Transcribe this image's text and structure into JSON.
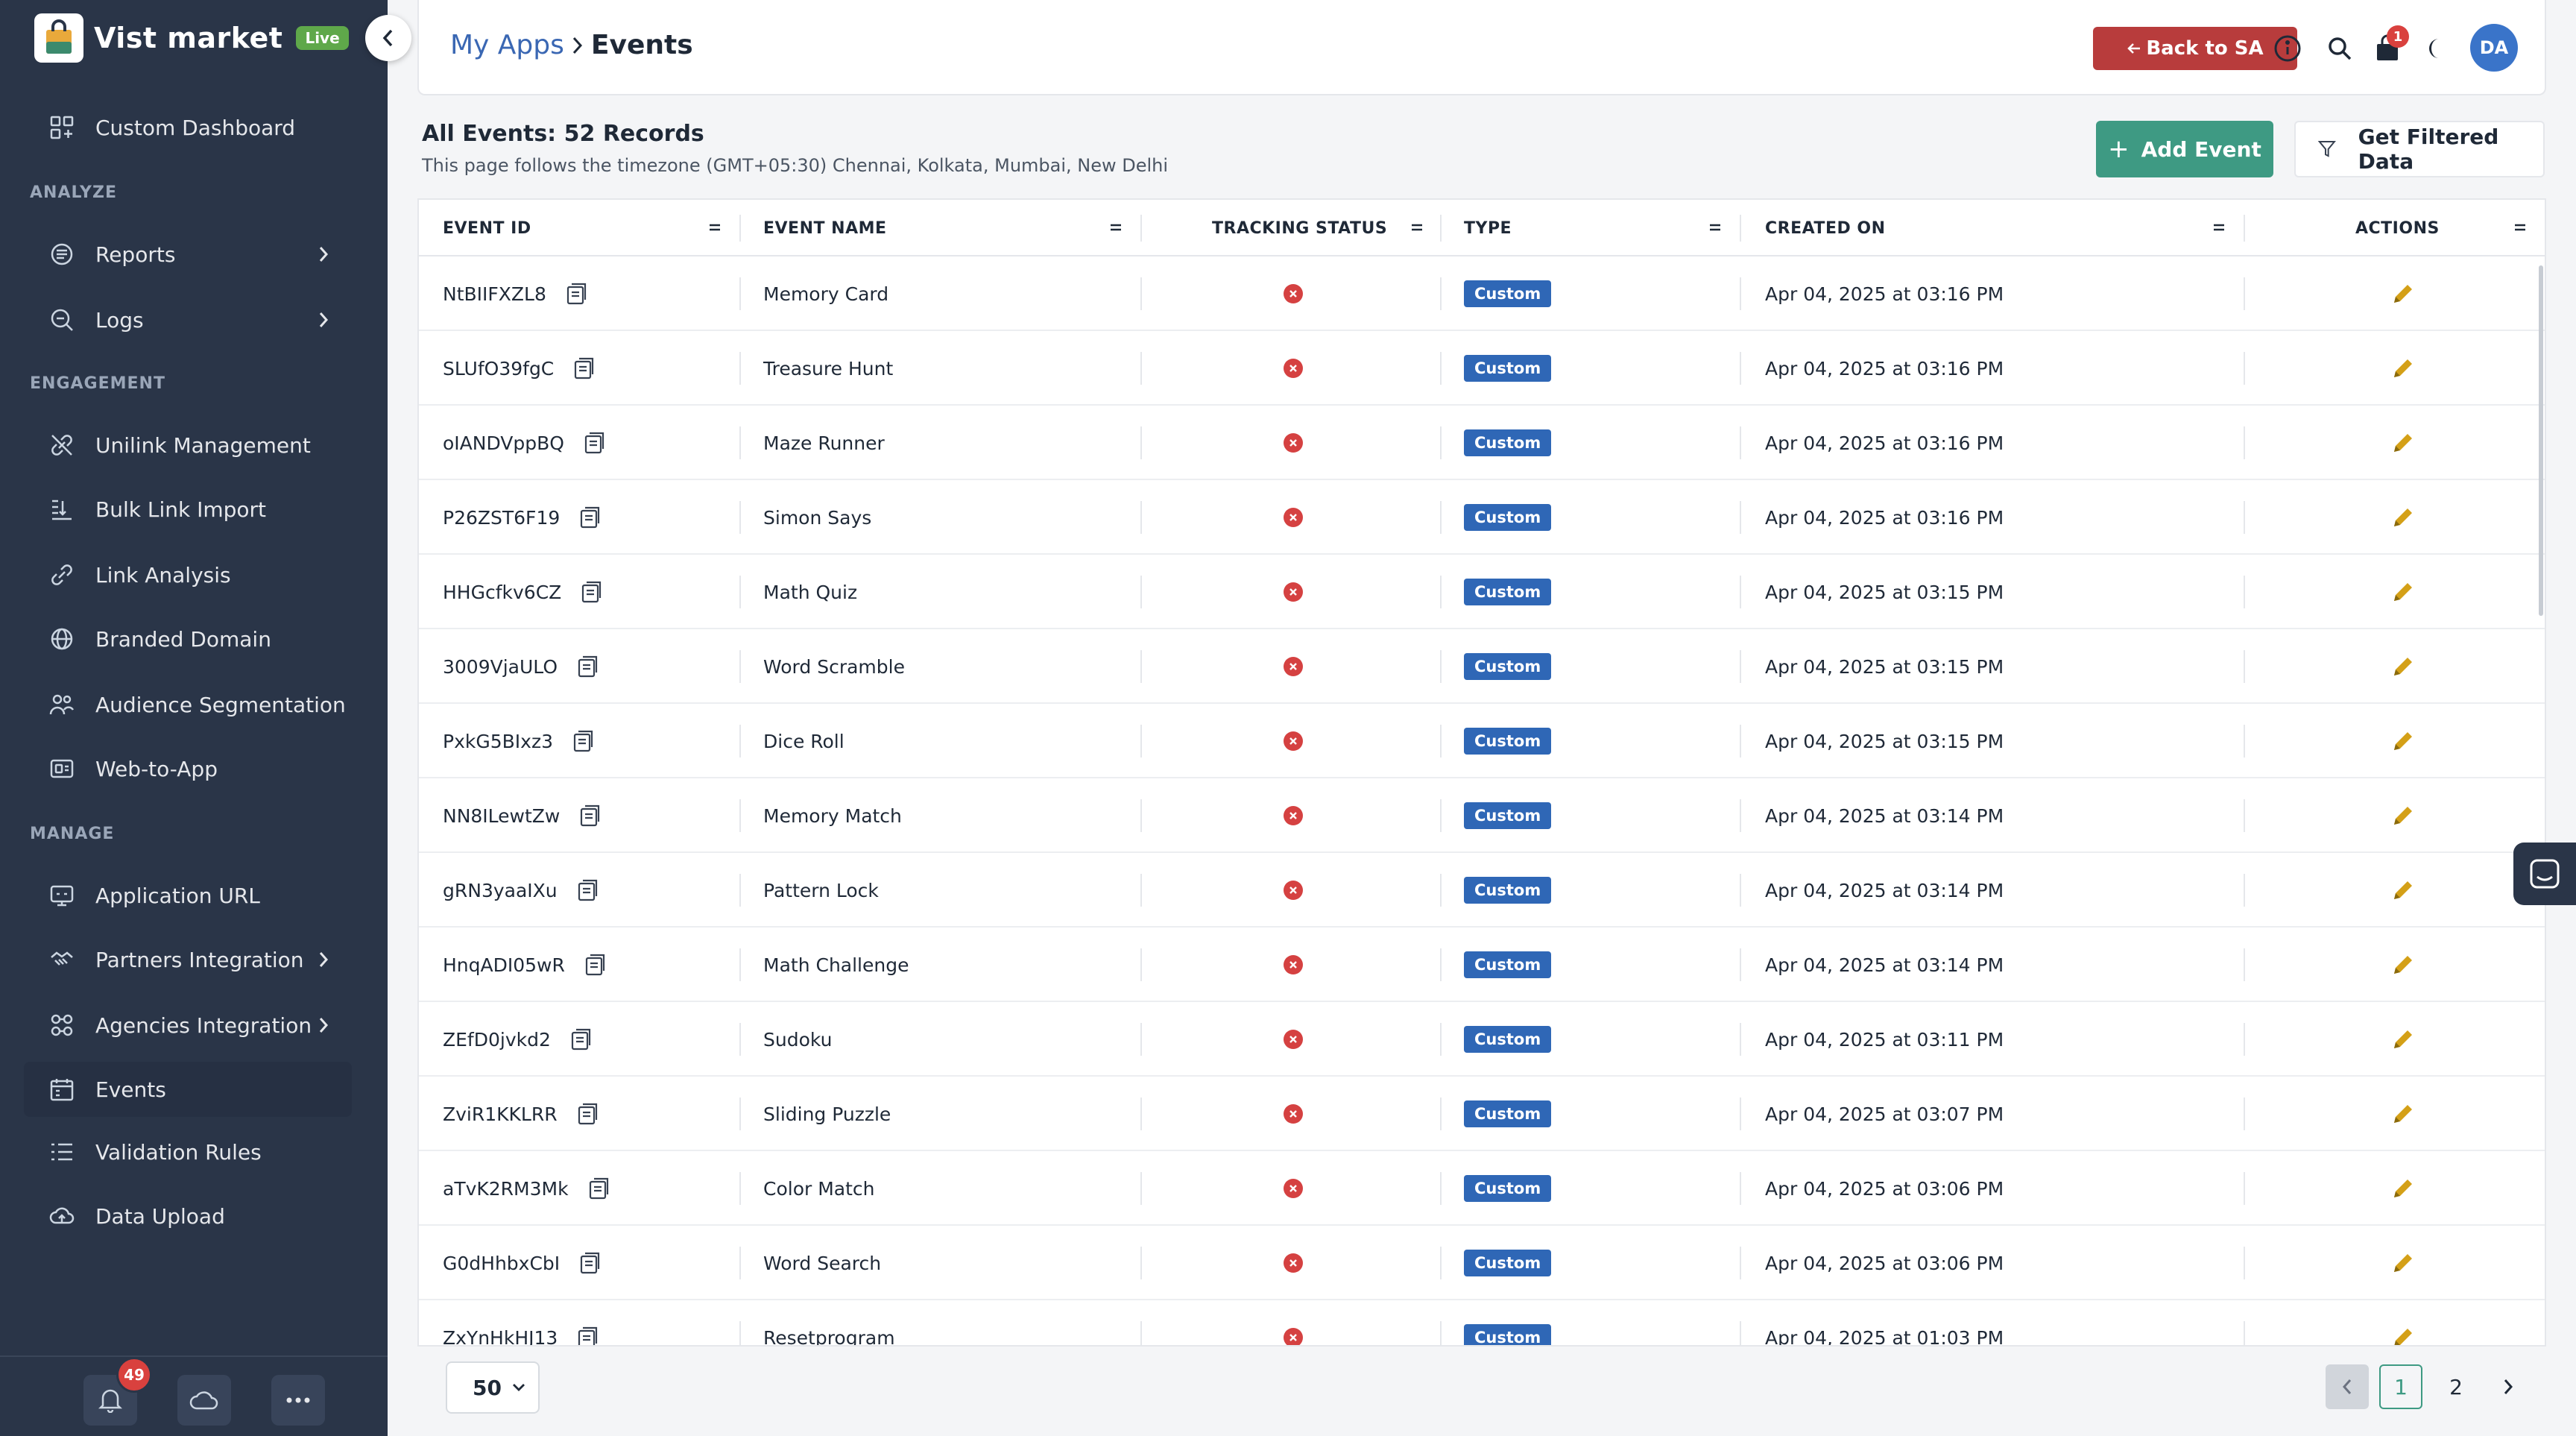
{
  "app": {
    "brand_name": "Vist market",
    "live_label": "Live"
  },
  "sidebar": {
    "custom_dashboard": "Custom Dashboard",
    "sections": {
      "analyze": "ANALYZE",
      "engagement": "ENGAGEMENT",
      "manage": "MANAGE"
    },
    "analyze_items": [
      {
        "label": "Reports",
        "icon": "reports-icon"
      },
      {
        "label": "Logs",
        "icon": "logs-icon"
      }
    ],
    "engagement_items": [
      {
        "label": "Unilink Management",
        "icon": "unilink-icon"
      },
      {
        "label": "Bulk Link Import",
        "icon": "bulk-import-icon"
      },
      {
        "label": "Link Analysis",
        "icon": "link-icon"
      },
      {
        "label": "Branded Domain",
        "icon": "globe-icon"
      },
      {
        "label": "Audience Segmentation",
        "icon": "audience-icon"
      },
      {
        "label": "Web-to-App",
        "icon": "web-to-app-icon"
      }
    ],
    "manage_items": [
      {
        "label": "Application URL",
        "icon": "application-url-icon"
      },
      {
        "label": "Partners Integration",
        "icon": "partners-icon"
      },
      {
        "label": "Agencies Integration",
        "icon": "agencies-icon"
      },
      {
        "label": "Events",
        "icon": "calendar-icon",
        "active": true
      },
      {
        "label": "Validation Rules",
        "icon": "list-icon"
      },
      {
        "label": "Data Upload",
        "icon": "cloud-upload-icon"
      }
    ],
    "notification_count": "49"
  },
  "header": {
    "breadcrumb_parent": "My Apps",
    "breadcrumb_current": "Events",
    "back_button": "Back to SA",
    "cart_count": "1",
    "avatar_initials": "DA"
  },
  "page": {
    "title": "All Events: 52 Records",
    "timezone_note": "This page follows the timezone (GMT+05:30) Chennai, Kolkata, Mumbai, New Delhi",
    "add_button": "Add Event",
    "filter_button": "Get Filtered Data"
  },
  "table": {
    "columns": {
      "event_id": "EVENT ID",
      "event_name": "EVENT NAME",
      "tracking_status": "TRACKING STATUS",
      "type": "TYPE",
      "created_on": "CREATED ON",
      "actions": "ACTIONS"
    },
    "rows": [
      {
        "id": "NtBIIFXZL8",
        "name": "Memory Card",
        "status": "inactive",
        "type": "Custom",
        "created": "Apr 04, 2025 at 03:16 PM"
      },
      {
        "id": "SLUfO39fgC",
        "name": "Treasure Hunt",
        "status": "inactive",
        "type": "Custom",
        "created": "Apr 04, 2025 at 03:16 PM"
      },
      {
        "id": "oIANDVppBQ",
        "name": "Maze Runner",
        "status": "inactive",
        "type": "Custom",
        "created": "Apr 04, 2025 at 03:16 PM"
      },
      {
        "id": "P26ZST6F19",
        "name": "Simon Says",
        "status": "inactive",
        "type": "Custom",
        "created": "Apr 04, 2025 at 03:16 PM"
      },
      {
        "id": "HHGcfkv6CZ",
        "name": "Math Quiz",
        "status": "inactive",
        "type": "Custom",
        "created": "Apr 04, 2025 at 03:15 PM"
      },
      {
        "id": "3009VjaULO",
        "name": "Word Scramble",
        "status": "inactive",
        "type": "Custom",
        "created": "Apr 04, 2025 at 03:15 PM"
      },
      {
        "id": "PxkG5BIxz3",
        "name": "Dice Roll",
        "status": "inactive",
        "type": "Custom",
        "created": "Apr 04, 2025 at 03:15 PM"
      },
      {
        "id": "NN8ILewtZw",
        "name": "Memory Match",
        "status": "inactive",
        "type": "Custom",
        "created": "Apr 04, 2025 at 03:14 PM"
      },
      {
        "id": "gRN3yaaIXu",
        "name": "Pattern Lock",
        "status": "inactive",
        "type": "Custom",
        "created": "Apr 04, 2025 at 03:14 PM"
      },
      {
        "id": "HnqADI05wR",
        "name": "Math Challenge",
        "status": "inactive",
        "type": "Custom",
        "created": "Apr 04, 2025 at 03:14 PM"
      },
      {
        "id": "ZEfD0jvkd2",
        "name": "Sudoku",
        "status": "inactive",
        "type": "Custom",
        "created": "Apr 04, 2025 at 03:11 PM"
      },
      {
        "id": "ZviR1KKLRR",
        "name": "Sliding Puzzle",
        "status": "inactive",
        "type": "Custom",
        "created": "Apr 04, 2025 at 03:07 PM"
      },
      {
        "id": "aTvK2RM3Mk",
        "name": "Color Match",
        "status": "inactive",
        "type": "Custom",
        "created": "Apr 04, 2025 at 03:06 PM"
      },
      {
        "id": "G0dHhbxCbI",
        "name": "Word Search",
        "status": "inactive",
        "type": "Custom",
        "created": "Apr 04, 2025 at 03:06 PM"
      },
      {
        "id": "ZxYnHkHJ13",
        "name": "Resetprogram",
        "status": "inactive",
        "type": "Custom",
        "created": "Apr 04, 2025 at 01:03 PM"
      }
    ]
  },
  "pagination": {
    "page_size": "50",
    "pages": [
      "1",
      "2"
    ],
    "current_page": "1"
  },
  "colors": {
    "sidebar_bg": "#2a3548",
    "accent_green": "#3e9a83",
    "back_red": "#b83c3c",
    "badge_blue": "#2f67b6",
    "status_red": "#d54141",
    "edit_gold": "#d4a017",
    "link_blue": "#3a67b3"
  }
}
